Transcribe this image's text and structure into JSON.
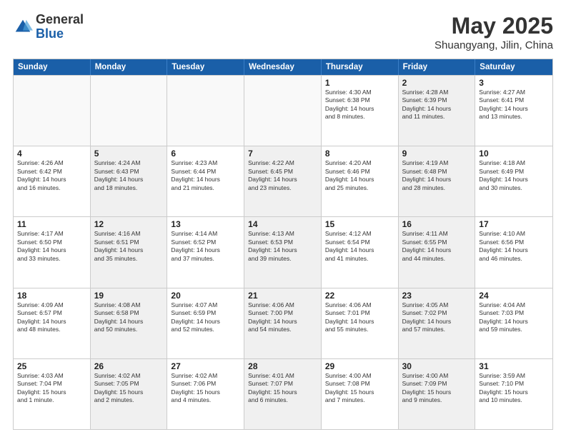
{
  "header": {
    "logo_general": "General",
    "logo_blue": "Blue",
    "month_title": "May 2025",
    "location": "Shuangyang, Jilin, China"
  },
  "weekdays": [
    "Sunday",
    "Monday",
    "Tuesday",
    "Wednesday",
    "Thursday",
    "Friday",
    "Saturday"
  ],
  "rows": [
    [
      {
        "day": "",
        "text": "",
        "empty": true
      },
      {
        "day": "",
        "text": "",
        "empty": true
      },
      {
        "day": "",
        "text": "",
        "empty": true
      },
      {
        "day": "",
        "text": "",
        "empty": true
      },
      {
        "day": "1",
        "text": "Sunrise: 4:30 AM\nSunset: 6:38 PM\nDaylight: 14 hours\nand 8 minutes.",
        "empty": false,
        "shaded": false
      },
      {
        "day": "2",
        "text": "Sunrise: 4:28 AM\nSunset: 6:39 PM\nDaylight: 14 hours\nand 11 minutes.",
        "empty": false,
        "shaded": true
      },
      {
        "day": "3",
        "text": "Sunrise: 4:27 AM\nSunset: 6:41 PM\nDaylight: 14 hours\nand 13 minutes.",
        "empty": false,
        "shaded": false
      }
    ],
    [
      {
        "day": "4",
        "text": "Sunrise: 4:26 AM\nSunset: 6:42 PM\nDaylight: 14 hours\nand 16 minutes.",
        "empty": false,
        "shaded": false
      },
      {
        "day": "5",
        "text": "Sunrise: 4:24 AM\nSunset: 6:43 PM\nDaylight: 14 hours\nand 18 minutes.",
        "empty": false,
        "shaded": true
      },
      {
        "day": "6",
        "text": "Sunrise: 4:23 AM\nSunset: 6:44 PM\nDaylight: 14 hours\nand 21 minutes.",
        "empty": false,
        "shaded": false
      },
      {
        "day": "7",
        "text": "Sunrise: 4:22 AM\nSunset: 6:45 PM\nDaylight: 14 hours\nand 23 minutes.",
        "empty": false,
        "shaded": true
      },
      {
        "day": "8",
        "text": "Sunrise: 4:20 AM\nSunset: 6:46 PM\nDaylight: 14 hours\nand 25 minutes.",
        "empty": false,
        "shaded": false
      },
      {
        "day": "9",
        "text": "Sunrise: 4:19 AM\nSunset: 6:48 PM\nDaylight: 14 hours\nand 28 minutes.",
        "empty": false,
        "shaded": true
      },
      {
        "day": "10",
        "text": "Sunrise: 4:18 AM\nSunset: 6:49 PM\nDaylight: 14 hours\nand 30 minutes.",
        "empty": false,
        "shaded": false
      }
    ],
    [
      {
        "day": "11",
        "text": "Sunrise: 4:17 AM\nSunset: 6:50 PM\nDaylight: 14 hours\nand 33 minutes.",
        "empty": false,
        "shaded": false
      },
      {
        "day": "12",
        "text": "Sunrise: 4:16 AM\nSunset: 6:51 PM\nDaylight: 14 hours\nand 35 minutes.",
        "empty": false,
        "shaded": true
      },
      {
        "day": "13",
        "text": "Sunrise: 4:14 AM\nSunset: 6:52 PM\nDaylight: 14 hours\nand 37 minutes.",
        "empty": false,
        "shaded": false
      },
      {
        "day": "14",
        "text": "Sunrise: 4:13 AM\nSunset: 6:53 PM\nDaylight: 14 hours\nand 39 minutes.",
        "empty": false,
        "shaded": true
      },
      {
        "day": "15",
        "text": "Sunrise: 4:12 AM\nSunset: 6:54 PM\nDaylight: 14 hours\nand 41 minutes.",
        "empty": false,
        "shaded": false
      },
      {
        "day": "16",
        "text": "Sunrise: 4:11 AM\nSunset: 6:55 PM\nDaylight: 14 hours\nand 44 minutes.",
        "empty": false,
        "shaded": true
      },
      {
        "day": "17",
        "text": "Sunrise: 4:10 AM\nSunset: 6:56 PM\nDaylight: 14 hours\nand 46 minutes.",
        "empty": false,
        "shaded": false
      }
    ],
    [
      {
        "day": "18",
        "text": "Sunrise: 4:09 AM\nSunset: 6:57 PM\nDaylight: 14 hours\nand 48 minutes.",
        "empty": false,
        "shaded": false
      },
      {
        "day": "19",
        "text": "Sunrise: 4:08 AM\nSunset: 6:58 PM\nDaylight: 14 hours\nand 50 minutes.",
        "empty": false,
        "shaded": true
      },
      {
        "day": "20",
        "text": "Sunrise: 4:07 AM\nSunset: 6:59 PM\nDaylight: 14 hours\nand 52 minutes.",
        "empty": false,
        "shaded": false
      },
      {
        "day": "21",
        "text": "Sunrise: 4:06 AM\nSunset: 7:00 PM\nDaylight: 14 hours\nand 54 minutes.",
        "empty": false,
        "shaded": true
      },
      {
        "day": "22",
        "text": "Sunrise: 4:06 AM\nSunset: 7:01 PM\nDaylight: 14 hours\nand 55 minutes.",
        "empty": false,
        "shaded": false
      },
      {
        "day": "23",
        "text": "Sunrise: 4:05 AM\nSunset: 7:02 PM\nDaylight: 14 hours\nand 57 minutes.",
        "empty": false,
        "shaded": true
      },
      {
        "day": "24",
        "text": "Sunrise: 4:04 AM\nSunset: 7:03 PM\nDaylight: 14 hours\nand 59 minutes.",
        "empty": false,
        "shaded": false
      }
    ],
    [
      {
        "day": "25",
        "text": "Sunrise: 4:03 AM\nSunset: 7:04 PM\nDaylight: 15 hours\nand 1 minute.",
        "empty": false,
        "shaded": false
      },
      {
        "day": "26",
        "text": "Sunrise: 4:02 AM\nSunset: 7:05 PM\nDaylight: 15 hours\nand 2 minutes.",
        "empty": false,
        "shaded": true
      },
      {
        "day": "27",
        "text": "Sunrise: 4:02 AM\nSunset: 7:06 PM\nDaylight: 15 hours\nand 4 minutes.",
        "empty": false,
        "shaded": false
      },
      {
        "day": "28",
        "text": "Sunrise: 4:01 AM\nSunset: 7:07 PM\nDaylight: 15 hours\nand 6 minutes.",
        "empty": false,
        "shaded": true
      },
      {
        "day": "29",
        "text": "Sunrise: 4:00 AM\nSunset: 7:08 PM\nDaylight: 15 hours\nand 7 minutes.",
        "empty": false,
        "shaded": false
      },
      {
        "day": "30",
        "text": "Sunrise: 4:00 AM\nSunset: 7:09 PM\nDaylight: 15 hours\nand 9 minutes.",
        "empty": false,
        "shaded": true
      },
      {
        "day": "31",
        "text": "Sunrise: 3:59 AM\nSunset: 7:10 PM\nDaylight: 15 hours\nand 10 minutes.",
        "empty": false,
        "shaded": false
      }
    ]
  ]
}
